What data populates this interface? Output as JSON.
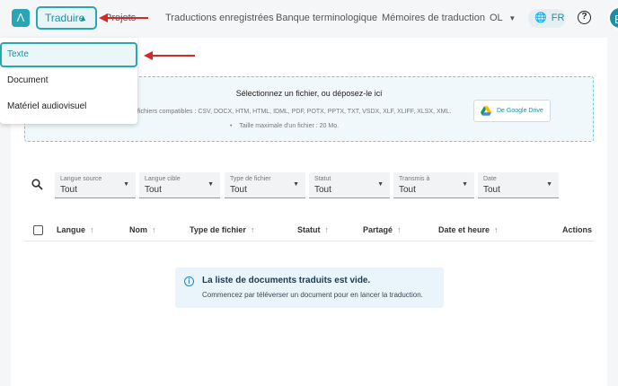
{
  "nav": {
    "logo_glyph": "Λ",
    "translate_label": "Traduire",
    "projects_label": "Projets",
    "saved_translations": "Traductions enregistrées",
    "termbase": "Banque terminologique",
    "tm": "Mémoires de traduction",
    "org": "OL",
    "lang": "FR",
    "help": "?",
    "avatar": "E"
  },
  "menu": {
    "items": [
      {
        "label": "Texte",
        "active": true
      },
      {
        "label": "Document",
        "active": false
      },
      {
        "label": "Matériel audiovisuel",
        "active": false
      }
    ]
  },
  "upload": {
    "title": "Sélectionnez un fichier, ou déposez-le ici",
    "formats": "ats de fichiers compatibles : CSV, DOCX, HTM, HTML, IDML, PDF, POTX, PPTX, TXT, VSDX, XLF, XLIFF, XLSX, XML.",
    "max_size": "Taille maximale d'un fichier : 20 Mo.",
    "gdrive": "De Google Drive"
  },
  "filters": [
    {
      "label": "Langue source",
      "value": "Tout"
    },
    {
      "label": "Langue cible",
      "value": "Tout"
    },
    {
      "label": "Type de fichier",
      "value": "Tout"
    },
    {
      "label": "Statut",
      "value": "Tout"
    },
    {
      "label": "Transmis à",
      "value": "Tout"
    },
    {
      "label": "Date",
      "value": "Tout"
    }
  ],
  "table": {
    "columns": [
      "Langue",
      "Nom",
      "Type de fichier",
      "Statut",
      "Partagé",
      "Date et heure",
      "Actions"
    ]
  },
  "empty": {
    "title": "La liste de documents traduits est vide.",
    "subtitle": "Commencez par téléverser un document pour en lancer la traduction."
  },
  "colors": {
    "accent": "#2aa5b3",
    "annotation": "#d62828"
  }
}
